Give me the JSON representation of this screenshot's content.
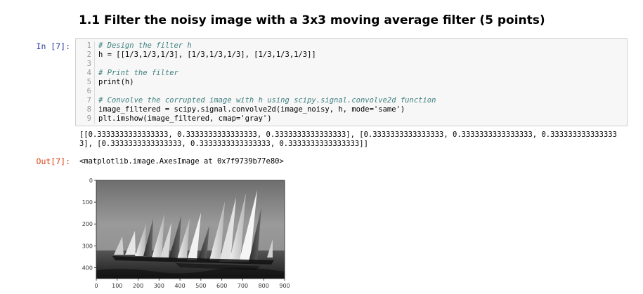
{
  "heading": "1.1 Filter the noisy image with a 3x3 moving average filter (5 points)",
  "prompts": {
    "input": "In [7]:",
    "output": "Out[7]:"
  },
  "code_lines": [
    {
      "n": "1",
      "t": "# Design the filter h"
    },
    {
      "n": "2",
      "t": "h = [[1/3,1/3,1/3], [1/3,1/3,1/3], [1/3,1/3,1/3]]"
    },
    {
      "n": "3",
      "t": ""
    },
    {
      "n": "4",
      "t": "# Print the filter"
    },
    {
      "n": "5",
      "t": "print(h)"
    },
    {
      "n": "6",
      "t": ""
    },
    {
      "n": "7",
      "t": "# Convolve the corrupted image with h using scipy.signal.convolve2d function"
    },
    {
      "n": "8",
      "t": "image_filtered = scipy.signal.convolve2d(image_noisy, h, mode='same')"
    },
    {
      "n": "9",
      "t": "plt.imshow(image_filtered, cmap='gray')"
    }
  ],
  "stdout": "[[0.3333333333333333, 0.3333333333333333, 0.3333333333333333], [0.3333333333333333, 0.3333333333333333, 0.3333333333333333], [0.3333333333333333, 0.3333333333333333, 0.3333333333333333]]",
  "result_repr": "<matplotlib.image.AxesImage at 0x7f9739b77e80>",
  "plot": {
    "x_ticks": [
      "0",
      "100",
      "200",
      "300",
      "400",
      "500",
      "600",
      "700",
      "800",
      "900"
    ],
    "y_ticks": [
      "0",
      "100",
      "200",
      "300",
      "400"
    ],
    "x_max": 900,
    "y_max": 450,
    "colormap": "gray"
  }
}
